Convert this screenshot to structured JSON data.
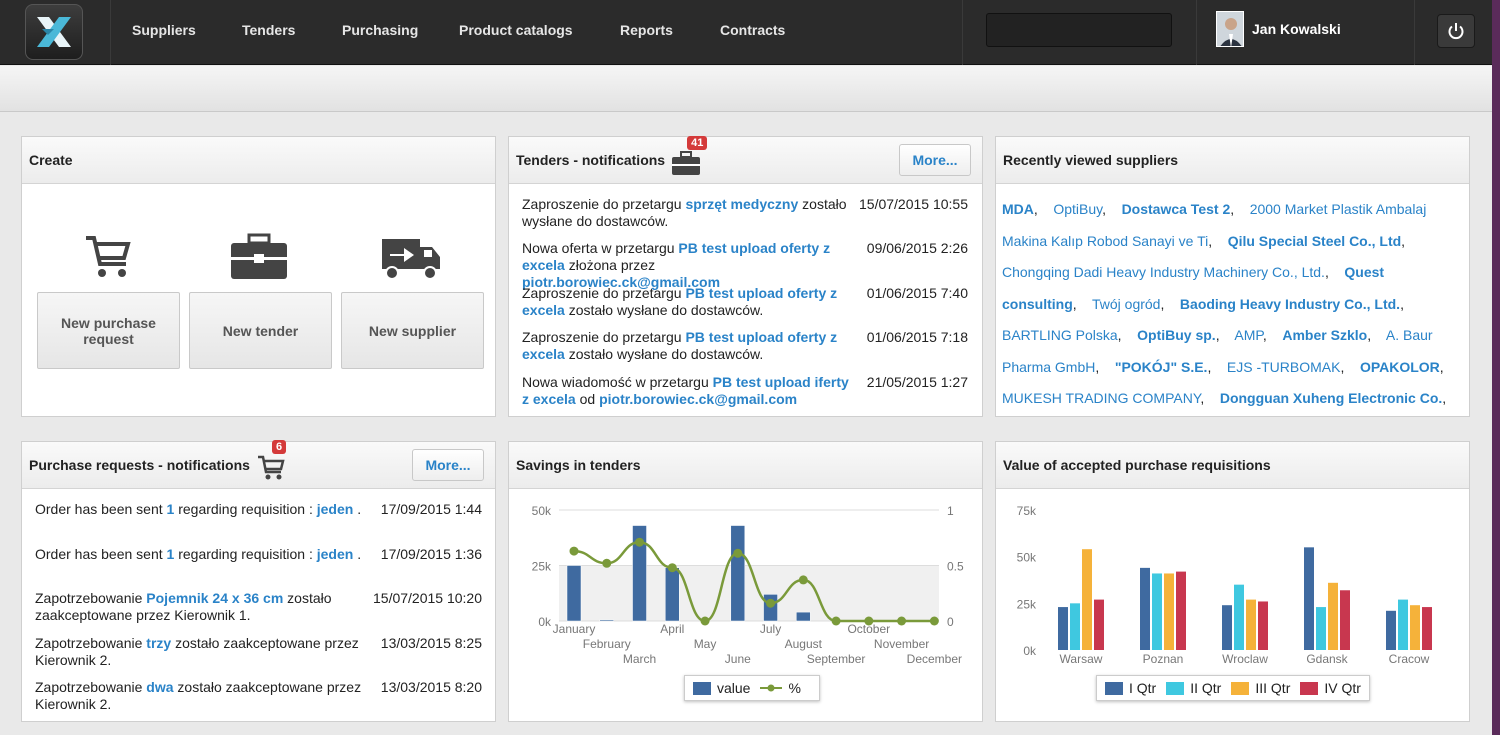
{
  "nav": {
    "items": [
      "Suppliers",
      "Tenders",
      "Purchasing",
      "Product catalogs",
      "Reports",
      "Contracts"
    ],
    "user_name": "Jan Kowalski"
  },
  "create": {
    "title": "Create",
    "buttons": [
      "New purchase request",
      "New tender",
      "New supplier"
    ]
  },
  "tenders": {
    "title": "Tenders - notifications",
    "badge": "41",
    "more": "More...",
    "rows": [
      {
        "pre": "Zaproszenie do przetargu ",
        "link": "sprzęt medyczny",
        "post": " zostało wysłane do dostawców.",
        "date": "15/07/2015 10:55"
      },
      {
        "pre": "Nowa oferta w przetargu ",
        "link": "PB test upload oferty z excela",
        "post": " złożona przez ",
        "link2": "piotr.borowiec.ck@gmail.com",
        "date": "09/06/2015 2:26"
      },
      {
        "pre": "Zaproszenie do przetargu ",
        "link": "PB test upload oferty z excela",
        "post": " zostało wysłane do dostawców.",
        "date": "01/06/2015 7:40"
      },
      {
        "pre": "Zaproszenie do przetargu ",
        "link": "PB test upload oferty z excela",
        "post": " zostało wysłane do dostawców.",
        "date": "01/06/2015 7:18"
      },
      {
        "pre": "Nowa wiadomość w przetargu ",
        "link": "PB test upload iferty z excela",
        "post": " od ",
        "link2": "piotr.borowiec.ck@gmail.com",
        "date": "21/05/2015 1:27"
      }
    ]
  },
  "suppliers": {
    "title": "Recently viewed suppliers",
    "list": [
      {
        "name": "MDA",
        "bold": true
      },
      {
        "name": "OptiBuy",
        "bold": false
      },
      {
        "name": "Dostawca Test 2",
        "bold": true
      },
      {
        "name": "2000 Market Plastik Ambalaj Makina Kalıp Robod Sanayi ve Ti",
        "bold": false
      },
      {
        "name": "Qilu Special Steel Co., Ltd",
        "bold": true
      },
      {
        "name": "Chongqing Dadi Heavy Industry Machinery Co., Ltd.",
        "bold": false
      },
      {
        "name": "Quest consulting",
        "bold": true
      },
      {
        "name": "Twój ogród",
        "bold": false
      },
      {
        "name": "Baoding Heavy Industry Co., Ltd.",
        "bold": true
      },
      {
        "name": "BARTLING Polska",
        "bold": false
      },
      {
        "name": "OptiBuy sp.",
        "bold": true
      },
      {
        "name": "AMP",
        "bold": false
      },
      {
        "name": "Amber Szklo",
        "bold": true
      },
      {
        "name": "A. Baur Pharma GmbH",
        "bold": false
      },
      {
        "name": "\"POKÓJ\" S.E.",
        "bold": true
      },
      {
        "name": "EJS -TURBOMAK",
        "bold": false
      },
      {
        "name": "OPAKOLOR",
        "bold": true
      },
      {
        "name": "MUKESH TRADING COMPANY",
        "bold": false
      },
      {
        "name": "Dongguan Xuheng Electronic Co.",
        "bold": true
      }
    ]
  },
  "purchase": {
    "title": "Purchase requests - notifications",
    "badge": "6",
    "more": "More...",
    "rows": [
      {
        "pre": "Order has been sent ",
        "link": "1",
        "mid": " regarding requisition : ",
        "link2": "jeden",
        "post": " .",
        "date": "17/09/2015 1:44"
      },
      {
        "pre": "Order has been sent ",
        "link": "1",
        "mid": " regarding requisition : ",
        "link2": "jeden",
        "post": " .",
        "date": "17/09/2015 1:36"
      },
      {
        "pre": "Zapotrzebowanie ",
        "link": "Pojemnik 24 x 36 cm",
        "mid": " zostało zaakceptowane przez Kierownik 1.",
        "date": "15/07/2015 10:20"
      },
      {
        "pre": "Zapotrzebowanie ",
        "link": "trzy",
        "mid": " zostało zaakceptowane przez Kierownik 2.",
        "date": "13/03/2015 8:25"
      },
      {
        "pre": "Zapotrzebowanie ",
        "link": "dwa",
        "mid": " zostało zaakceptowane przez Kierownik 2.",
        "date": "13/03/2015 8:20"
      }
    ]
  },
  "savings": {
    "title": "Savings in tenders",
    "legend": [
      "value",
      "%"
    ]
  },
  "accepted": {
    "title": "Value of accepted purchase requisitions",
    "legend": [
      "I Qtr",
      "II Qtr",
      "III Qtr",
      "IV Qtr"
    ]
  },
  "colors": {
    "link": "#2a83c8",
    "bar_blue": "#3f6aa0",
    "line_green": "#7a9a3a",
    "q1": "#3f6aa0",
    "q2": "#3fc8e0",
    "q3": "#f5b23a",
    "q4": "#c8374f"
  },
  "chart_data": [
    {
      "type": "bar",
      "title": "Savings in tenders",
      "categories": [
        "January",
        "February",
        "March",
        "April",
        "May",
        "June",
        "July",
        "August",
        "September",
        "October",
        "November",
        "December"
      ],
      "series": [
        {
          "name": "value",
          "values": [
            25000,
            500,
            43000,
            24000,
            0,
            43000,
            12000,
            4000,
            0,
            0,
            0,
            0
          ]
        },
        {
          "name": "%",
          "values": [
            0.63,
            0.52,
            0.71,
            0.48,
            0,
            0.61,
            0.16,
            0.37,
            0,
            0,
            0,
            0
          ]
        }
      ],
      "ylim": [
        0,
        50000
      ],
      "y2lim": [
        0,
        1
      ],
      "yticks": [
        "50k",
        "25k",
        "0k"
      ],
      "y2ticks": [
        "1",
        "0.5",
        "0"
      ]
    },
    {
      "type": "bar",
      "title": "Value of accepted purchase requisitions",
      "categories": [
        "Warsaw",
        "Poznan",
        "Wroclaw",
        "Gdansk",
        "Cracow"
      ],
      "series": [
        {
          "name": "I Qtr",
          "values": [
            23000,
            44000,
            24000,
            55000,
            21000
          ]
        },
        {
          "name": "II Qtr",
          "values": [
            25000,
            41000,
            35000,
            23000,
            27000
          ]
        },
        {
          "name": "III Qtr",
          "values": [
            54000,
            41000,
            27000,
            36000,
            24000
          ]
        },
        {
          "name": "IV Qtr",
          "values": [
            27000,
            42000,
            26000,
            32000,
            23000
          ]
        }
      ],
      "ylim": [
        0,
        75000
      ],
      "yticks": [
        "75k",
        "50k",
        "25k",
        "0k"
      ]
    }
  ]
}
